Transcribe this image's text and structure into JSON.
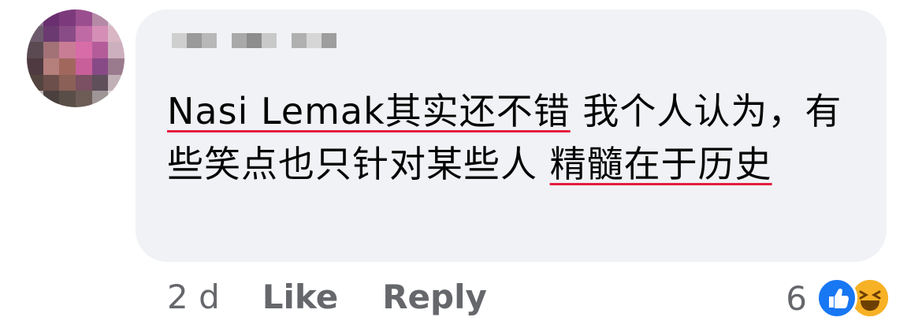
{
  "comment": {
    "text_line1_underlined": "Nasi Lemak其实还不错",
    "text_line1_rest": " 我个人认为，有些笑点也只针对某些人 ",
    "text_line2_underlined": "精髓在于历史"
  },
  "meta": {
    "time": "2 d",
    "like_label": "Like",
    "reply_label": "Reply",
    "reaction_count": "6"
  },
  "icons": {
    "like": "thumbs-up-reaction-icon",
    "haha": "haha-reaction-icon"
  },
  "colors": {
    "bubble": "#f0f2f5",
    "meta": "#65676b",
    "spellcheck": "#e41e3f",
    "like": "#1877f2",
    "haha": "#f7b125"
  }
}
